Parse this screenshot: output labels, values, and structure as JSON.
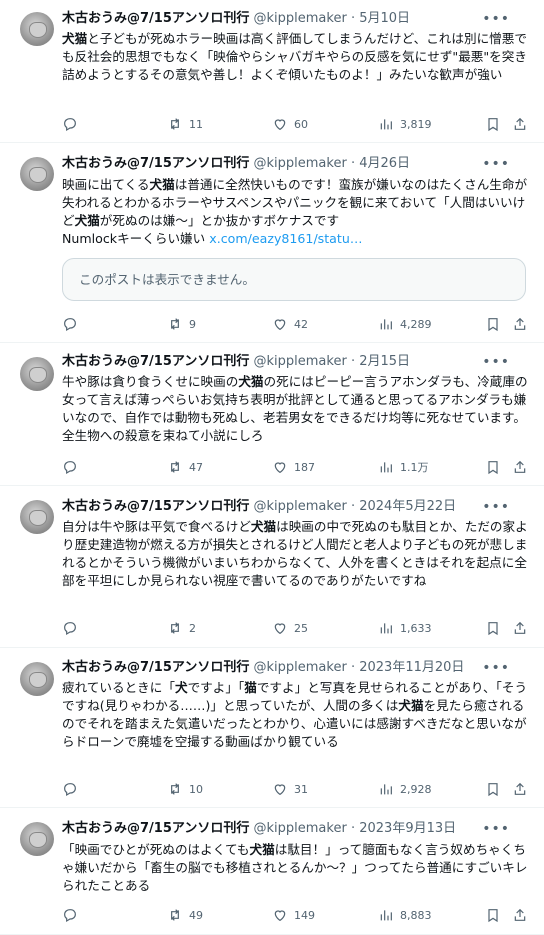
{
  "author": {
    "name": "木古おうみ@7/15アンソロ刊行",
    "handle": "@kipplemaker"
  },
  "tweets": [
    {
      "date": "5月10日",
      "segments": [
        {
          "t": "犬猫",
          "b": true
        },
        {
          "t": "と子どもが死ぬホラー映画は高く評価してしまうんだけど、これは別に憎悪でも反社会的思想でもなく「映倫やらシャバガキやらの反感を気にせず\"最悪\"を突き詰めようとするその意気や善し！よくぞ傾いたものよ！」みたいな歓声が強い"
        }
      ],
      "replies": "",
      "reposts": "11",
      "likes": "60",
      "views": "3,819"
    },
    {
      "date": "4月26日",
      "segments": [
        {
          "t": "映画に出てくる"
        },
        {
          "t": "犬猫",
          "b": true
        },
        {
          "t": "は普通に全然快いものです！蛮族が嫌いなのはたくさん生命が失われるとわかるホラーやサスペンスやパニックを観に来ておいて「人間はいいけど"
        },
        {
          "t": "犬猫",
          "b": true
        },
        {
          "t": "が死ぬのは嫌〜」とか抜かすボケナスです\nNumlockキーくらい嫌い "
        },
        {
          "t": "x.com/eazy8161/statu…",
          "link": true
        }
      ],
      "quote": "このポストは表示できません。",
      "replies": "",
      "reposts": "9",
      "likes": "42",
      "views": "4,289"
    },
    {
      "date": "2月15日",
      "segments": [
        {
          "t": "牛や豚は貪り食うくせに映画の"
        },
        {
          "t": "犬猫",
          "b": true
        },
        {
          "t": "の死にはピーピー言うアホンダラも、冷蔵庫の女って言えば薄っぺらいお気持ち表明が批評として通ると思ってるアホンダラも嫌いなので、自作では動物も死ぬし、老若男女をできるだけ均等に死なせています。全生物への殺意を束ねて小説にしろ"
        }
      ],
      "replies": "",
      "reposts": "47",
      "likes": "187",
      "views": "1.1万"
    },
    {
      "date": "2024年5月22日",
      "segments": [
        {
          "t": "自分は牛や豚は平気で食べるけど"
        },
        {
          "t": "犬猫",
          "b": true
        },
        {
          "t": "は映画の中で死ぬのも駄目とか、ただの家より歴史建造物が燃える方が損失とされるけど人間だと老人より子どもの死が悲しまれるとかそういう機微がいまいちわからなくて、人外を書くときはそれを起点に全部を平坦にしか見られない視座で書いてるのでありがたいですね"
        }
      ],
      "replies": "",
      "reposts": "2",
      "likes": "25",
      "views": "1,633"
    },
    {
      "date": "2023年11月20日",
      "segments": [
        {
          "t": "疲れているときに「"
        },
        {
          "t": "犬",
          "b": true
        },
        {
          "t": "ですよ」「"
        },
        {
          "t": "猫",
          "b": true
        },
        {
          "t": "ですよ」と写真を見せられることがあり、「そうですね(見りゃわかる……)」と思っていたが、人間の多くは"
        },
        {
          "t": "犬猫",
          "b": true
        },
        {
          "t": "を見たら癒されるのでそれを踏まえた気遣いだったとわかり、心遣いには感謝すべきだなと思いながらドローンで廃墟を空撮する動画ばかり観ている"
        }
      ],
      "replies": "",
      "reposts": "10",
      "likes": "31",
      "views": "2,928"
    },
    {
      "date": "2023年9月13日",
      "segments": [
        {
          "t": "「映画でひとが死ぬのはよくても"
        },
        {
          "t": "犬猫",
          "b": true
        },
        {
          "t": "は駄目！」って臆面もなく言う奴めちゃくちゃ嫌いだから「畜生の脳でも移植されとるんか〜？」つってたら普通にすごいキレられたことある"
        }
      ],
      "replies": "",
      "reposts": "49",
      "likes": "149",
      "views": "8,883"
    }
  ],
  "icons": {
    "reply": "reply-icon",
    "repost": "repost-icon",
    "like": "heart-icon",
    "views": "views-icon",
    "bookmark": "bookmark-icon",
    "share": "share-icon",
    "more": "more-icon"
  },
  "colors": {
    "link": "#1d9bf0",
    "secondary": "#536471",
    "border": "#eff3f4"
  }
}
